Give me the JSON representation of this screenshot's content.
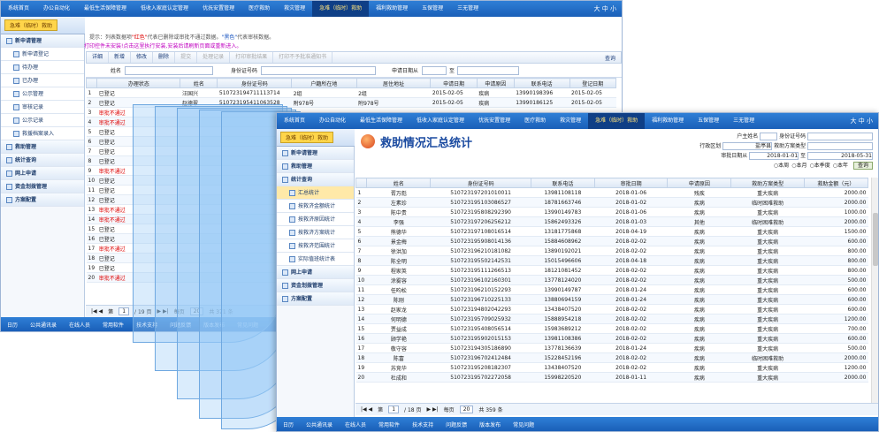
{
  "nav_tabs": [
    "系统首页",
    "办公自动化",
    "最低生活保障管理",
    "低收入家庭认定管理",
    "优抚安置管理",
    "医疗救助",
    "救灾管理",
    "急难（临时）救助",
    "福利救助管理",
    "五保管理",
    "三无管理"
  ],
  "nav_right": "大 中 小",
  "back": {
    "module_badge": "急难（临时）救助",
    "tip_prefix": "提示：列表数据项",
    "tip_red": "\"红色\"",
    "tip_mid": "代表已删除或审批不通过数据。",
    "tip_blue": "\"黑色\"",
    "tip_suffix": "代表审核数据。",
    "warn": "打印控件未安装!点击这里执行安装,安装后请刷新页面或重新进入。",
    "sidebar": [
      {
        "label": "新申请管理",
        "type": "group"
      },
      {
        "label": "新申请登记",
        "type": "sub"
      },
      {
        "label": "待办理",
        "type": "sub"
      },
      {
        "label": "已办理",
        "type": "sub"
      },
      {
        "label": "公示管理",
        "type": "sub"
      },
      {
        "label": "审核记录",
        "type": "sub"
      },
      {
        "label": "公示记录",
        "type": "sub"
      },
      {
        "label": "救援档案录入",
        "type": "sub"
      },
      {
        "label": "救助管理",
        "type": "group"
      },
      {
        "label": "统计查询",
        "type": "group"
      },
      {
        "label": "网上申请",
        "type": "group"
      },
      {
        "label": "资金划拨管理",
        "type": "group"
      },
      {
        "label": "方案配置",
        "type": "group"
      }
    ],
    "toolbar": [
      "详细",
      "新增",
      "修改",
      "删除",
      "提交",
      "处理记录",
      "打印审批结果",
      "打印不予批准通知书"
    ],
    "query_label": "查询",
    "filters": {
      "name": "姓名",
      "idno": "身份证号码",
      "date": "申请日期从",
      "to": "至"
    },
    "columns": [
      "",
      "办理状态",
      "姓名",
      "身份证号码",
      "户籍所在地",
      "居住地址",
      "申请日期",
      "申请原因",
      "联系电话",
      "登记日期"
    ],
    "rows": [
      {
        "n": "1",
        "status": "已登记",
        "red": false,
        "name": "汪国兴",
        "id": "510723194711113714",
        "hj": "2组",
        "addr": "2组",
        "date": "2015-02-05",
        "reason": "疾病",
        "tel": "13990198396",
        "reg": "2015-02-05"
      },
      {
        "n": "2",
        "status": "已登记",
        "red": false,
        "name": "赵德翠",
        "id": "510723195411063528",
        "hj": "附978号",
        "addr": "附978号",
        "date": "2015-02-05",
        "reason": "疾病",
        "tel": "13990186125",
        "reg": "2015-02-05"
      },
      {
        "n": "3",
        "status": "审批不通过",
        "red": true,
        "name": "",
        "id": "",
        "hj": "",
        "addr": "",
        "date": "",
        "reason": "",
        "tel": "",
        "reg": ""
      },
      {
        "n": "4",
        "status": "审批不通过",
        "red": true,
        "name": "",
        "id": "",
        "hj": "",
        "addr": "",
        "date": "",
        "reason": "",
        "tel": "",
        "reg": ""
      },
      {
        "n": "5",
        "status": "已登记",
        "red": false,
        "name": "",
        "id": "",
        "hj": "",
        "addr": "",
        "date": "",
        "reason": "",
        "tel": "",
        "reg": ""
      },
      {
        "n": "6",
        "status": "已登记",
        "red": false,
        "name": "",
        "id": "",
        "hj": "",
        "addr": "",
        "date": "",
        "reason": "",
        "tel": "",
        "reg": ""
      },
      {
        "n": "7",
        "status": "已登记",
        "red": false,
        "name": "",
        "id": "",
        "hj": "",
        "addr": "",
        "date": "",
        "reason": "",
        "tel": "",
        "reg": ""
      },
      {
        "n": "8",
        "status": "已登记",
        "red": false,
        "name": "",
        "id": "",
        "hj": "",
        "addr": "",
        "date": "",
        "reason": "",
        "tel": "",
        "reg": ""
      },
      {
        "n": "9",
        "status": "审批不通过",
        "red": true,
        "name": "",
        "id": "",
        "hj": "",
        "addr": "",
        "date": "",
        "reason": "",
        "tel": "",
        "reg": ""
      },
      {
        "n": "10",
        "status": "已登记",
        "red": false,
        "name": "",
        "id": "",
        "hj": "",
        "addr": "",
        "date": "",
        "reason": "",
        "tel": "",
        "reg": ""
      },
      {
        "n": "11",
        "status": "已登记",
        "red": false,
        "name": "",
        "id": "",
        "hj": "",
        "addr": "",
        "date": "",
        "reason": "",
        "tel": "",
        "reg": ""
      },
      {
        "n": "12",
        "status": "已登记",
        "red": false,
        "name": "",
        "id": "",
        "hj": "",
        "addr": "",
        "date": "",
        "reason": "",
        "tel": "",
        "reg": ""
      },
      {
        "n": "13",
        "status": "审批不通过",
        "red": true,
        "name": "",
        "id": "",
        "hj": "",
        "addr": "",
        "date": "",
        "reason": "",
        "tel": "",
        "reg": ""
      },
      {
        "n": "14",
        "status": "审批不通过",
        "red": true,
        "name": "",
        "id": "",
        "hj": "",
        "addr": "",
        "date": "",
        "reason": "",
        "tel": "",
        "reg": ""
      },
      {
        "n": "15",
        "status": "已登记",
        "red": false,
        "name": "",
        "id": "",
        "hj": "",
        "addr": "",
        "date": "",
        "reason": "",
        "tel": "",
        "reg": ""
      },
      {
        "n": "16",
        "status": "已登记",
        "red": false,
        "name": "",
        "id": "",
        "hj": "",
        "addr": "",
        "date": "",
        "reason": "",
        "tel": "",
        "reg": ""
      },
      {
        "n": "17",
        "status": "审批不通过",
        "red": true,
        "name": "",
        "id": "",
        "hj": "",
        "addr": "",
        "date": "",
        "reason": "",
        "tel": "",
        "reg": ""
      },
      {
        "n": "18",
        "status": "已登记",
        "red": false,
        "name": "",
        "id": "",
        "hj": "",
        "addr": "",
        "date": "",
        "reason": "",
        "tel": "",
        "reg": ""
      },
      {
        "n": "19",
        "status": "已登记",
        "red": false,
        "name": "",
        "id": "",
        "hj": "",
        "addr": "",
        "date": "",
        "reason": "",
        "tel": "",
        "reg": ""
      },
      {
        "n": "20",
        "status": "审批不通过",
        "red": true,
        "name": "",
        "id": "",
        "hj": "",
        "addr": "",
        "date": "",
        "reason": "",
        "tel": "",
        "reg": ""
      }
    ],
    "pager": {
      "page_label": "第",
      "page": "1",
      "total": "/ 19 页",
      "per_label": "每页",
      "per": "20",
      "count": "共 371 条"
    }
  },
  "front": {
    "module_badge": "急难（临时）救助",
    "title": "救助情况汇总统计",
    "sidebar": [
      {
        "label": "新申请管理",
        "type": "group"
      },
      {
        "label": "救助管理",
        "type": "group"
      },
      {
        "label": "统计查询",
        "type": "group"
      },
      {
        "label": "汇总统计",
        "type": "sub",
        "sel": true
      },
      {
        "label": "按救济金额统计",
        "type": "sub"
      },
      {
        "label": "按救济原因统计",
        "type": "sub"
      },
      {
        "label": "按救济方案统计",
        "type": "sub"
      },
      {
        "label": "按救济范围统计",
        "type": "sub"
      },
      {
        "label": "实际值班统计表",
        "type": "sub"
      },
      {
        "label": "网上申请",
        "type": "group"
      },
      {
        "label": "资金划拨管理",
        "type": "group"
      },
      {
        "label": "方案配置",
        "type": "group"
      }
    ],
    "filters": {
      "hz": "户主姓名",
      "idno": "身份证号码",
      "area": "行政区划",
      "area_val": "盐亭县",
      "plan": "救助方案类型",
      "date": "审批日期从",
      "from": "2018-01-01",
      "to": "至",
      "to_val": "2018-05-31",
      "opts": [
        "本周",
        "本月",
        "本季度",
        "本年"
      ],
      "query": "查询"
    },
    "columns": [
      "",
      "姓名",
      "身份证号码",
      "联系电话",
      "审批日期",
      "申请原因",
      "救助方案类型",
      "救助金额（元）"
    ],
    "rows": [
      {
        "n": "1",
        "name": "胥万彪",
        "id": "510723197201010011",
        "tel": "13981108118",
        "date": "2018-01-06",
        "reason": "残疾",
        "plan": "重大疾病",
        "amt": "2000.00"
      },
      {
        "n": "2",
        "name": "左素珍",
        "id": "510723195103086527",
        "tel": "18781663746",
        "date": "2018-01-02",
        "reason": "疾病",
        "plan": "临时困难救助",
        "amt": "2000.00"
      },
      {
        "n": "3",
        "name": "陈中贵",
        "id": "510723195808292390",
        "tel": "13990149783",
        "date": "2018-01-06",
        "reason": "疾病",
        "plan": "重大疾病",
        "amt": "1000.00"
      },
      {
        "n": "4",
        "name": "李强",
        "name2": "",
        "id": "510723197206256212",
        "tel": "15862493326",
        "date": "2018-01-03",
        "reason": "其他",
        "plan": "临时困难救助",
        "amt": "2000.00"
      },
      {
        "n": "5",
        "name": "熊德华",
        "id": "510723197108016514",
        "tel": "13181775868",
        "date": "2018-04-19",
        "reason": "疾病",
        "plan": "重大疾病",
        "amt": "1500.00"
      },
      {
        "n": "6",
        "name": "景金梅",
        "id": "510723195908014136",
        "tel": "15884608962",
        "date": "2018-02-02",
        "reason": "疾病",
        "plan": "重大疾病",
        "amt": "600.00"
      },
      {
        "n": "7",
        "name": "徐洪加",
        "id": "510723196210181082",
        "tel": "13890192021",
        "date": "2018-02-02",
        "reason": "疾病",
        "plan": "重大疾病",
        "amt": "800.00"
      },
      {
        "n": "8",
        "name": "陈全明",
        "id": "510723195502142531",
        "tel": "15015496606",
        "date": "2018-04-18",
        "reason": "疾病",
        "plan": "重大疾病",
        "amt": "800.00"
      },
      {
        "n": "9",
        "name": "程家英",
        "id": "510723195111266513",
        "tel": "18121081452",
        "date": "2018-02-02",
        "reason": "疾病",
        "plan": "重大疾病",
        "amt": "800.00"
      },
      {
        "n": "10",
        "name": "涂雾容",
        "id": "510723196102160301",
        "tel": "13778124020",
        "date": "2018-02-02",
        "reason": "疾病",
        "plan": "重大疾病",
        "amt": "500.00"
      },
      {
        "n": "11",
        "name": "任昀松",
        "id": "510723196210152293",
        "tel": "13990149787",
        "date": "2018-01-24",
        "reason": "疾病",
        "plan": "重大疾病",
        "amt": "600.00"
      },
      {
        "n": "12",
        "name": "陈刚",
        "id": "510723196710225133",
        "tel": "13880694159",
        "date": "2018-01-24",
        "reason": "疾病",
        "plan": "重大疾病",
        "amt": "600.00"
      },
      {
        "n": "13",
        "name": "赵家龙",
        "id": "510723194802042293",
        "tel": "13438407520",
        "date": "2018-02-02",
        "reason": "疾病",
        "plan": "重大疾病",
        "amt": "600.00"
      },
      {
        "n": "14",
        "name": "何明德",
        "id": "510723195709025932",
        "tel": "15888954218",
        "date": "2018-02-02",
        "reason": "疾病",
        "plan": "重大疾病",
        "amt": "1200.00"
      },
      {
        "n": "15",
        "name": "贾益成",
        "id": "510723195408056514",
        "tel": "15983689212",
        "date": "2018-02-02",
        "reason": "疾病",
        "plan": "重大疾病",
        "amt": "700.00"
      },
      {
        "n": "16",
        "name": "顾学艳",
        "id": "510723195902015153",
        "tel": "13981108386",
        "date": "2018-02-02",
        "reason": "疾病",
        "plan": "重大疾病",
        "amt": "600.00"
      },
      {
        "n": "17",
        "name": "敬守容",
        "id": "510723194305186890",
        "tel": "13778136639",
        "date": "2018-01-24",
        "reason": "疾病",
        "plan": "重大疾病",
        "amt": "500.00"
      },
      {
        "n": "18",
        "name": "陈富",
        "id": "510723196702412484",
        "tel": "15228452196",
        "date": "2018-02-02",
        "reason": "疾病",
        "plan": "临时困难救助",
        "amt": "2000.00"
      },
      {
        "n": "19",
        "name": "苏竞华",
        "id": "510723195208182307",
        "tel": "13438407520",
        "date": "2018-02-02",
        "reason": "疾病",
        "plan": "重大疾病",
        "amt": "1200.00"
      },
      {
        "n": "20",
        "name": "杜成和",
        "id": "510723195702272058",
        "tel": "15998220520",
        "date": "2018-01-11",
        "reason": "疾病",
        "plan": "重大疾病",
        "amt": "2000.00"
      }
    ],
    "pager": {
      "page_label": "第",
      "page": "1",
      "total": "/ 18 页",
      "per_label": "每页",
      "per": "20",
      "count": "共 359 条"
    }
  },
  "footer_items": [
    "日历",
    "公共通讯录",
    "在线人员",
    "常用软件",
    "技术支持",
    "问题反馈",
    "版本发布",
    "常见问题"
  ]
}
